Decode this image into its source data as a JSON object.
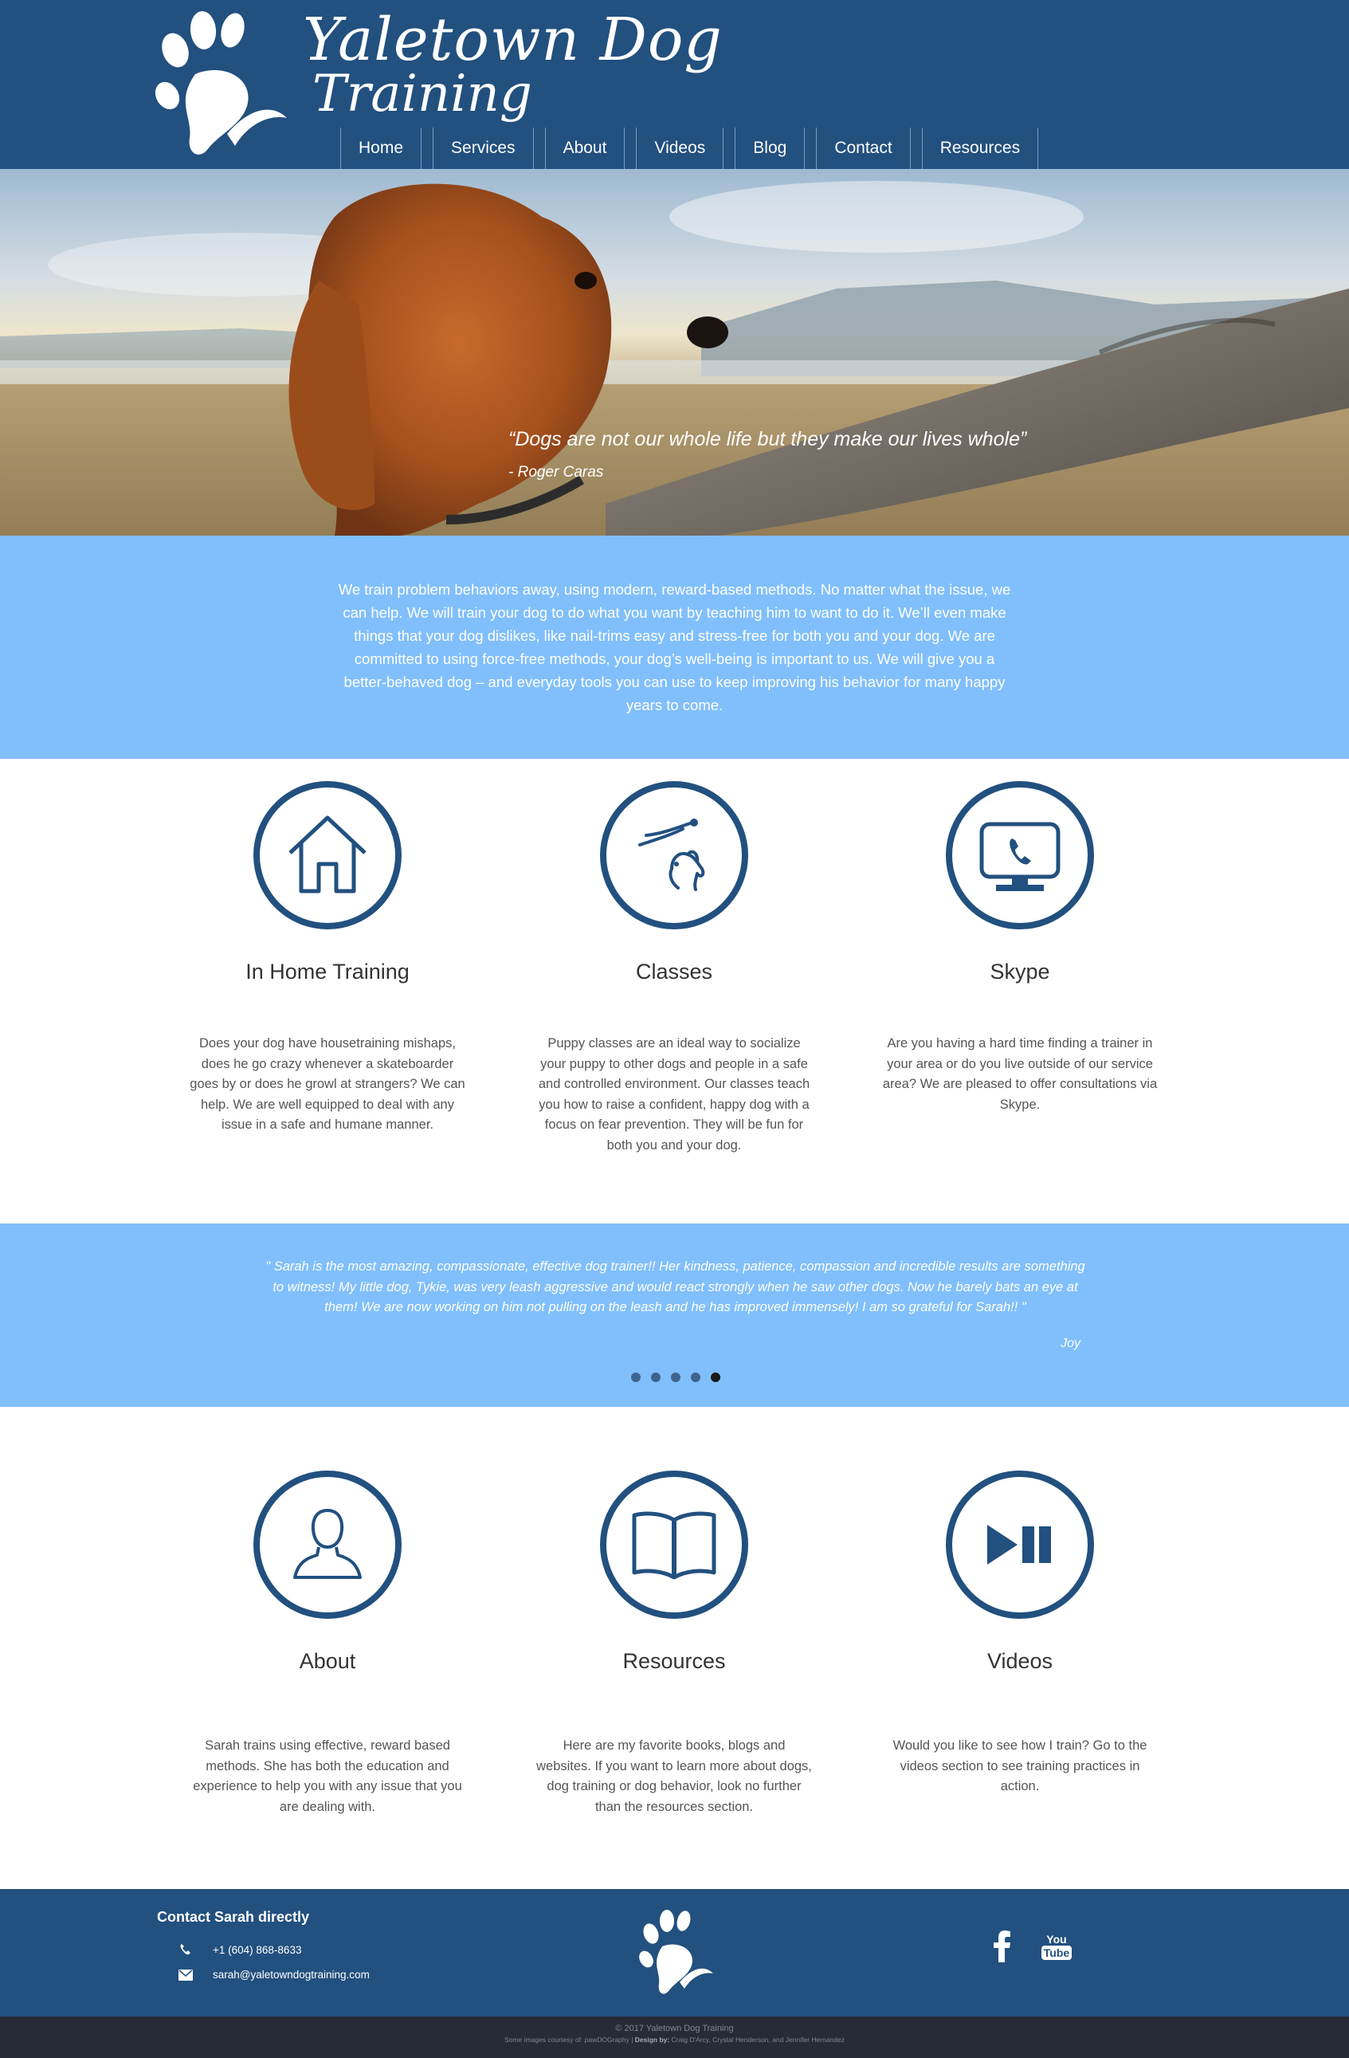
{
  "brand": {
    "name_line1": "Yaletown Dog",
    "name_line2": "Training",
    "color_primary": "#22507f",
    "color_light": "#80bffb"
  },
  "nav": [
    "Home",
    "Services",
    "About",
    "Videos",
    "Blog",
    "Contact",
    "Resources"
  ],
  "hero": {
    "quote": "“Dogs are not our whole life but they make our lives whole”",
    "author": "- Roger Caras"
  },
  "intro": "We train problem behaviors away, using modern, reward-based methods. No matter what the issue, we can help. We will train your dog to do what you want by teaching him to want to do it. We’ll even make things that your dog dislikes, like nail-trims easy and stress-free for both you and your dog. We are committed to using force-free methods, your dog’s well-being is important to us. We will give you a better-behaved dog – and everyday tools you can use to keep improving his behavior for many happy years to come.",
  "services": [
    {
      "icon": "house-icon",
      "title": "In Home Training",
      "text": "Does your dog have housetraining mishaps, does he go crazy whenever a skateboarder goes by or does he growl at strangers? We can help. We are well equipped to deal with any issue in a safe and humane manner."
    },
    {
      "icon": "dog-training-icon",
      "title": "Classes",
      "text": "Puppy classes are an ideal way to socialize your puppy to other dogs and people in a safe and controlled environment. Our classes teach you how to raise a confident, happy dog with a focus on fear prevention. They will be fun for both you and your dog."
    },
    {
      "icon": "video-phone-icon",
      "title": "Skype",
      "text": "Are you having a hard time finding a trainer in your area or do you live outside of our service area? We are pleased to offer consultations via Skype."
    }
  ],
  "testimonial": {
    "text": "\" Sarah is the most amazing, compassionate, effective dog trainer!! Her kindness, patience, compassion and incredible results are something to witness! My little dog, Tykie, was very leash aggressive and would react strongly when he saw other dogs. Now he barely bats an eye at them! We are now working on him not pulling on the leash and he has improved immensely! I am so grateful for Sarah!! \"",
    "name": "Joy",
    "slide_count": 5,
    "active_slide": 5
  },
  "features": [
    {
      "icon": "person-icon",
      "title": "About",
      "text": "Sarah trains using effective, reward based methods. She has both the education and experience to help you with any issue that you are dealing with."
    },
    {
      "icon": "book-icon",
      "title": "Resources",
      "text": "Here are my favorite books, blogs and websites. If you want to learn more about dogs, dog training or dog behavior, look no further than the resources section."
    },
    {
      "icon": "play-pause-icon",
      "title": "Videos",
      "text": "Would you like to see how I train? Go to the videos section to see training practices in action."
    }
  ],
  "footer": {
    "contact_title": "Contact Sarah directly",
    "phone": "+1 (604) 868-8633",
    "email": "sarah@yaletowndogtraining.com",
    "social": [
      "facebook-icon",
      "youtube-icon"
    ],
    "youtube_line1": "You",
    "youtube_line2": "Tube",
    "copyright": "© 2017 Yaletown Dog Training",
    "credits_prefix": "Some images courtesy of: pawDOGraphy",
    "credits_design_label": "Design by:",
    "credits_designers": "Craig D'Arcy, Crystal Henderson, and Jennifer Hernandez"
  }
}
